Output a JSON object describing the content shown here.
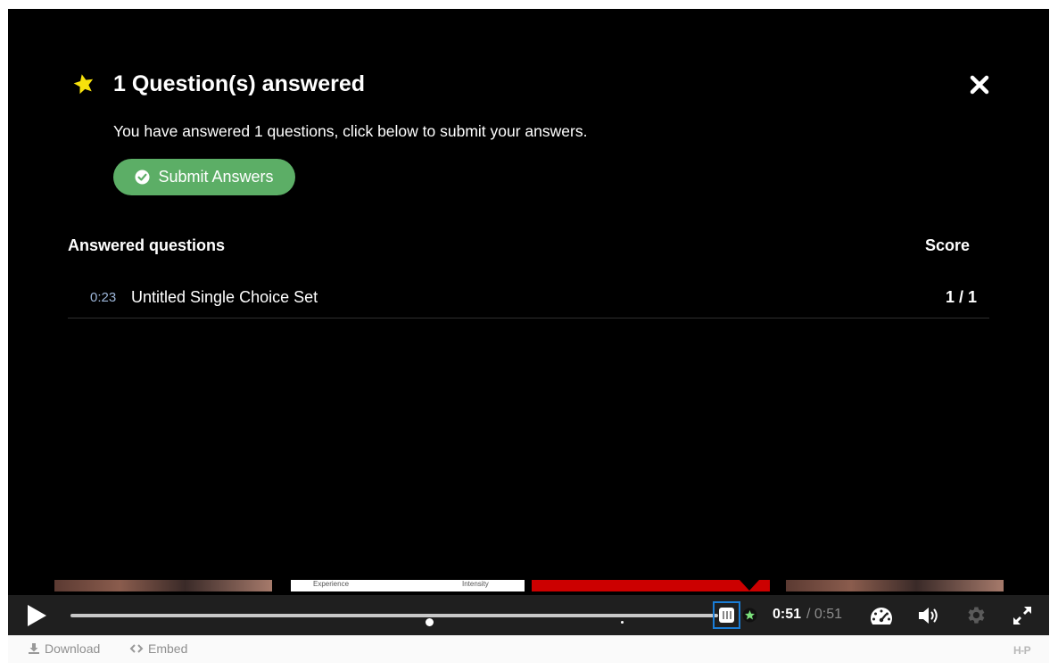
{
  "dialog": {
    "title": "1 Question(s) answered",
    "message": "You have answered 1 questions, click below to submit your answers.",
    "submit_label": "Submit Answers"
  },
  "table": {
    "header_left": "Answered questions",
    "header_right": "Score",
    "rows": [
      {
        "time": "0:23",
        "title": "Untitled Single Choice Set",
        "score": "1 / 1"
      }
    ]
  },
  "thumbnails": {
    "label_experience": "Experience",
    "label_intensity": "Intensity"
  },
  "controls": {
    "current_time": "0:51",
    "total_time": "/ 0:51",
    "progress_fraction": 1.0
  },
  "footer": {
    "download_label": "Download",
    "embed_label": "Embed",
    "logo_text": "H-P"
  },
  "colors": {
    "accent_green": "#5cae66",
    "star_yellow": "#f7e10c",
    "focus_blue": "#1a7dd6",
    "time_link": "#9db6d9"
  },
  "icons": [
    "star-icon",
    "close-icon",
    "check-circle-icon",
    "play-icon",
    "endscreen-icon",
    "speed-icon",
    "volume-icon",
    "gear-icon",
    "fullscreen-icon",
    "download-icon",
    "embed-icon"
  ]
}
